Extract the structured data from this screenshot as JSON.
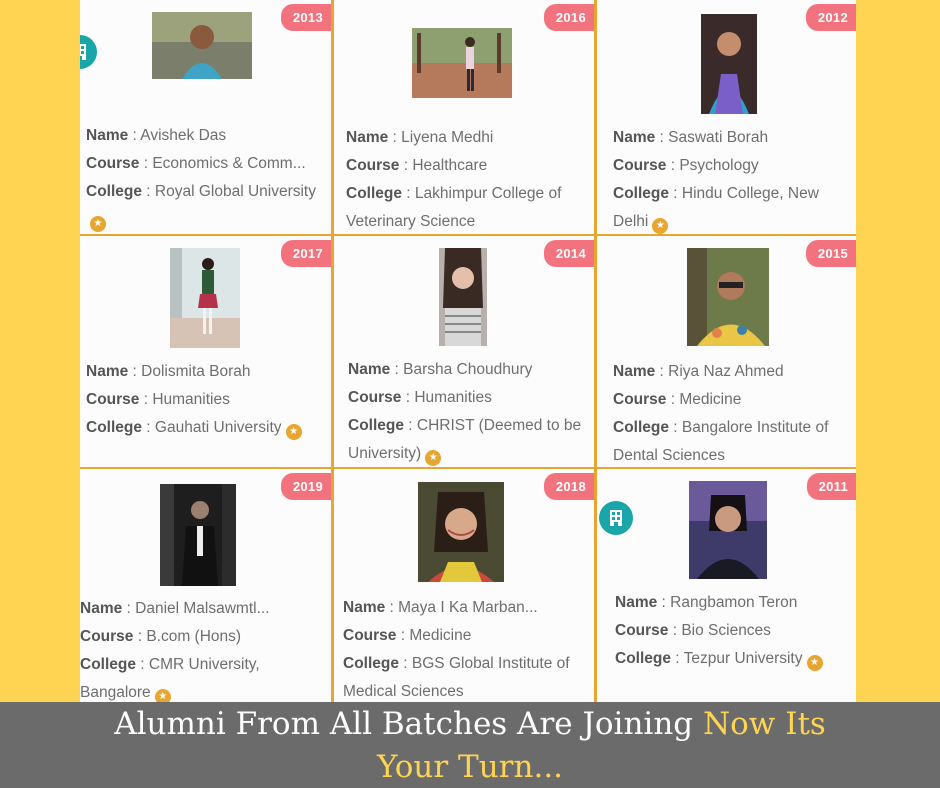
{
  "labels": {
    "name": "Name",
    "course": "Course",
    "college": "College"
  },
  "cards": [
    {
      "year": "2013",
      "name": "Avishek Das",
      "course": "Economics & Comm...",
      "college": "Royal Global University"
    },
    {
      "year": "2016",
      "name": "Liyena Medhi",
      "course": "Healthcare",
      "college": "Lakhimpur College of Veterinary Science"
    },
    {
      "year": "2012",
      "name": "Saswati Borah",
      "course": "Psychology",
      "college": "Hindu College, New Delhi"
    },
    {
      "year": "2017",
      "name": "Dolismita Borah",
      "course": "Humanities",
      "college": "Gauhati University"
    },
    {
      "year": "2014",
      "name": "Barsha Choudhury",
      "course": "Humanities",
      "college": "CHRIST (Deemed to be University)"
    },
    {
      "year": "2015",
      "name": "Riya Naz Ahmed",
      "course": "Medicine",
      "college": "Bangalore Institute of Dental Sciences"
    },
    {
      "year": "2019",
      "name": "Daniel Malsawmtl...",
      "course": "B.com (Hons)",
      "college": "CMR University, Bangalore"
    },
    {
      "year": "2018",
      "name": "Maya I Ka Marban...",
      "course": "Medicine",
      "college": "BGS Global Institute of Medical Sciences"
    },
    {
      "year": "2011",
      "name": "Rangbamon Teron",
      "course": "Bio Sciences",
      "college": "Tezpur University"
    }
  ],
  "banner": {
    "white": "Alumni From All Batches Are Joining ",
    "yellow_1": "Now Its",
    "yellow_2": "Your Turn..."
  },
  "icons": {
    "verified": "star-badge-icon",
    "institution": "building-icon"
  },
  "colors": {
    "background": "#FFD452",
    "year_badge": "#F2727E",
    "grid_border": "#E8A530",
    "banner": "#6B6B6B",
    "institution_icon": "#1AA6A8"
  }
}
